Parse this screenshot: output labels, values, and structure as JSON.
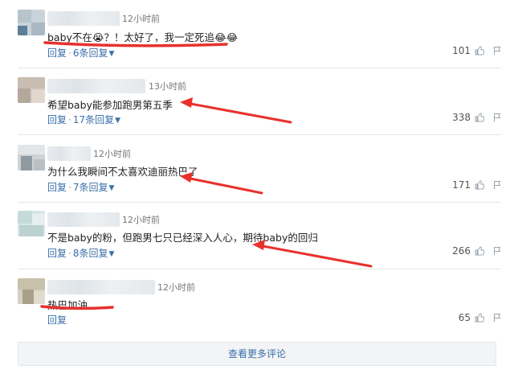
{
  "comments": [
    {
      "time": "12小时前",
      "text": "baby不在😭？！太好了，我一定死追😂😂",
      "reply_label": "回复",
      "replies_label": "6条回复",
      "likes": "101"
    },
    {
      "time": "13小时前",
      "text": "希望baby能参加跑男第五季",
      "reply_label": "回复",
      "replies_label": "17条回复",
      "likes": "338"
    },
    {
      "time": "12小时前",
      "text": "为什么我瞬间不太喜欢迪丽热巴了",
      "reply_label": "回复",
      "replies_label": "7条回复",
      "likes": "171"
    },
    {
      "time": "12小时前",
      "text": "不是baby的粉，但跑男七只已经深入人心，期待baby的回归",
      "reply_label": "回复",
      "replies_label": "8条回复",
      "likes": "266"
    },
    {
      "time": "12小时前",
      "text": "热巴加油",
      "reply_label": "回复",
      "likes": "65"
    }
  ],
  "load_more_label": "查看更多评论",
  "colors": {
    "link": "#3a6fa8",
    "annotation": "#e8312c"
  }
}
